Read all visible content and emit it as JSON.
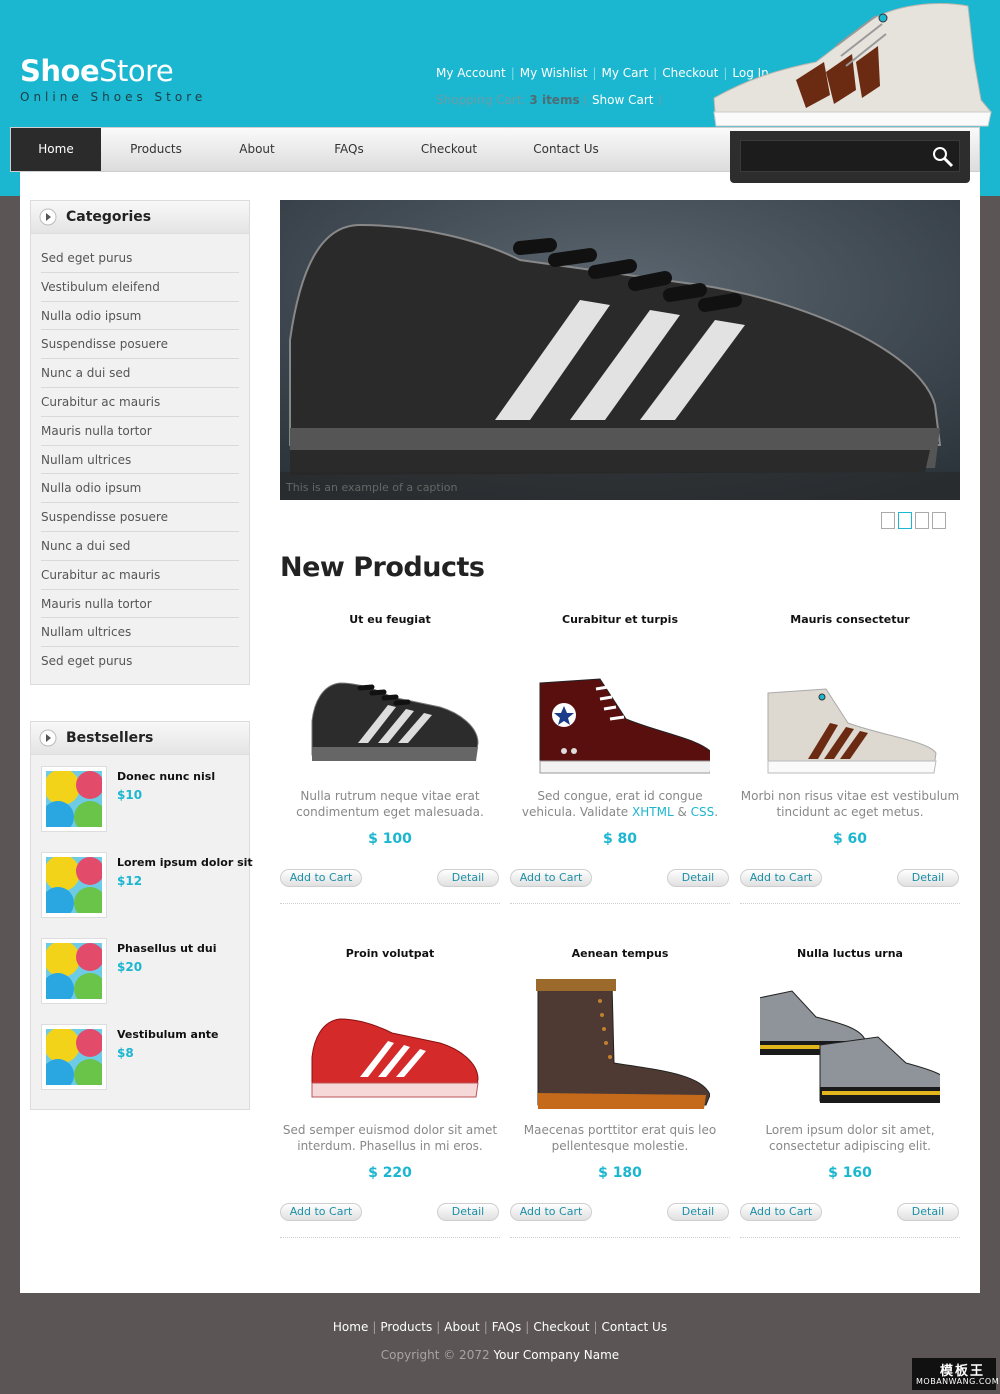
{
  "logo": {
    "main_bold": "Shoe",
    "main_light": "Store",
    "tagline": "Online Shoes Store"
  },
  "top_links": [
    "My Account",
    "My Wishlist",
    "My Cart",
    "Checkout",
    "Log In"
  ],
  "cart": {
    "label": "Shopping Cart:",
    "count": "3 items",
    "open_paren": "(",
    "show": "Show Cart",
    "close_paren": ")"
  },
  "nav": {
    "items": [
      "Home",
      "Products",
      "About",
      "FAQs",
      "Checkout",
      "Contact Us"
    ],
    "active": "Home"
  },
  "search": {
    "value": "",
    "placeholder": ""
  },
  "categories": {
    "title": "Categories",
    "items": [
      "Sed eget purus",
      "Vestibulum eleifend",
      "Nulla odio ipsum",
      "Suspendisse posuere",
      "Nunc a dui sed",
      "Curabitur ac mauris",
      "Mauris nulla tortor",
      "Nullam ultrices",
      "Nulla odio ipsum",
      "Suspendisse posuere",
      "Nunc a dui sed",
      "Curabitur ac mauris",
      "Mauris nulla tortor",
      "Nullam ultrices",
      "Sed eget purus"
    ]
  },
  "bestsellers": {
    "title": "Bestsellers",
    "items": [
      {
        "name": "Donec nunc nisl",
        "price": "$10"
      },
      {
        "name": "Lorem ipsum dolor sit",
        "price": "$12"
      },
      {
        "name": "Phasellus ut dui",
        "price": "$20"
      },
      {
        "name": "Vestibulum ante",
        "price": "$8"
      }
    ]
  },
  "slider": {
    "caption": "This is an example of a caption",
    "slides": 4,
    "active_slide": 2
  },
  "new_products": {
    "title": "New Products",
    "add_to_cart": "Add to Cart",
    "detail": "Detail",
    "items": [
      {
        "name": "Ut eu feugiat",
        "desc": "Nulla rutrum neque vitae erat condimentum eget malesuada.",
        "price": "$ 100",
        "image": "black-sneaker"
      },
      {
        "name": "Curabitur et turpis",
        "desc_pre": "Sed congue, erat id congue vehicula. Validate",
        "xhtml": "XHTML",
        "amp": "&",
        "css": "CSS",
        "dot": ".",
        "price": "$ 80",
        "image": "maroon-hightop"
      },
      {
        "name": "Mauris consectetur",
        "desc": "Morbi non risus vitae est vestibulum tincidunt ac eget metus.",
        "price": "$ 60",
        "image": "grey-hightop"
      },
      {
        "name": "Proin volutpat",
        "desc": "Sed semper euismod dolor sit amet interdum. Phasellus in mi eros.",
        "price": "$ 220",
        "image": "red-sneaker"
      },
      {
        "name": "Aenean tempus",
        "desc": "Maecenas porttitor erat quis leo pellentesque molestie.",
        "price": "$ 180",
        "image": "brown-boot"
      },
      {
        "name": "Nulla luctus urna",
        "desc": "Lorem ipsum dolor sit amet, consectetur adipiscing elit.",
        "price": "$ 160",
        "image": "grey-yellow-sneakers"
      }
    ]
  },
  "footer": {
    "links": [
      "Home",
      "Products",
      "About",
      "FAQs",
      "Checkout",
      "Contact Us"
    ],
    "copyright": "Copyright © 2072",
    "company": "Your Company Name"
  },
  "watermark": {
    "line1": "模板王",
    "line2": "MOBANWANG.COM"
  },
  "colors": {
    "accent": "#1bb6cf",
    "background": "#5b5555",
    "nav_active": "#2b2b2b"
  }
}
